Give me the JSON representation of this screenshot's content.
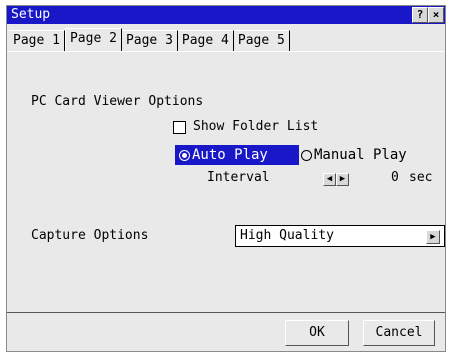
{
  "window": {
    "title": "Setup",
    "help_label": "?",
    "close_label": "×"
  },
  "tabs": [
    {
      "label": "Page 1",
      "active": false
    },
    {
      "label": "Page 2",
      "active": true
    },
    {
      "label": "Page 3",
      "active": false
    },
    {
      "label": "Page 4",
      "active": false
    },
    {
      "label": "Page 5",
      "active": false
    }
  ],
  "pc_card": {
    "section_label": "PC Card Viewer Options",
    "show_folder_list": {
      "label": "Show Folder List",
      "checked": false
    },
    "auto_play_label": "Auto Play",
    "manual_play_label": "Manual Play",
    "selected_mode": "Auto Play",
    "interval_label": "Interval",
    "interval_value": "0",
    "interval_unit": "sec"
  },
  "capture": {
    "label": "Capture Options",
    "value": "High Quality"
  },
  "buttons": {
    "ok": "OK",
    "cancel": "Cancel"
  },
  "colors": {
    "titlebar": "#1818c8",
    "selection": "#1818c8",
    "background": "#e9e9e9"
  },
  "icons": {
    "help": "question-icon",
    "close": "close-icon",
    "left_arrow": "arrow-left-icon",
    "right_arrow": "arrow-right-icon",
    "dropdown": "dropdown-arrow-icon"
  }
}
